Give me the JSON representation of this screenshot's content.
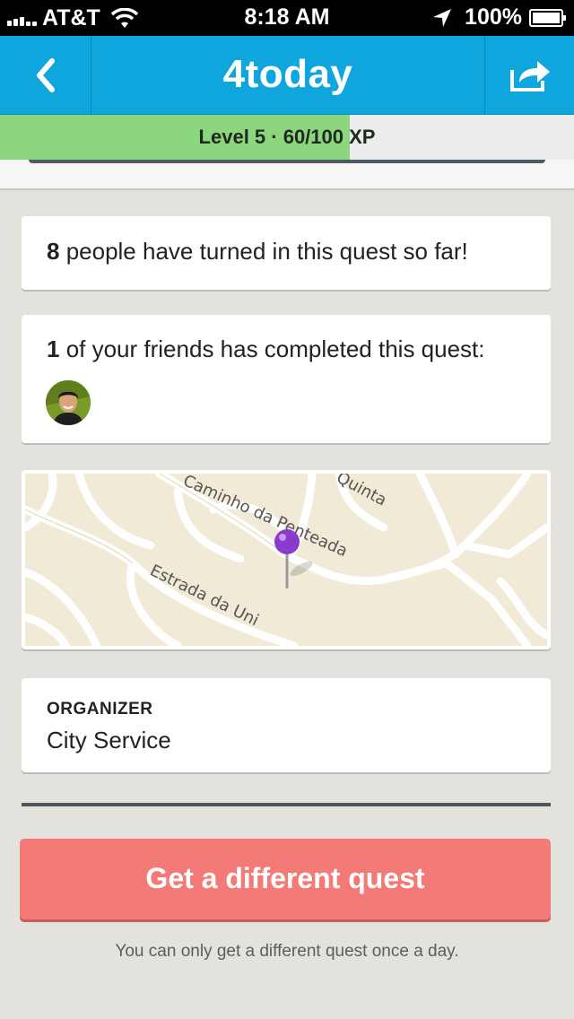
{
  "status_bar": {
    "carrier": "AT&T",
    "time": "8:18 AM",
    "battery": "100%",
    "icons": [
      "signal-icon",
      "wifi-icon",
      "location-icon",
      "battery-icon"
    ]
  },
  "nav": {
    "title": "4today",
    "back_icon": "chevron-left-icon",
    "share_icon": "share-icon"
  },
  "xp": {
    "label": "Level 5 · 60/100 XP",
    "level": 5,
    "current": 60,
    "max": 100,
    "progress": 0.61
  },
  "turned_in": {
    "count": "8",
    "text": " people have turned in this quest so far!"
  },
  "friends": {
    "count": "1",
    "text": " of your friends has completed this quest:"
  },
  "map": {
    "labels": [
      "Caminho da Penteada",
      "Estrada da Uni",
      "Quinta"
    ]
  },
  "organizer": {
    "label": "ORGANIZER",
    "value": "City Service"
  },
  "action": {
    "button_label": "Get a different quest",
    "note": "You can only get a different quest once a day."
  },
  "colors": {
    "nav_blue": "#0fa6de",
    "xp_green": "#8cd67e",
    "button_red": "#f47a78",
    "background": "#e3e2dc"
  }
}
